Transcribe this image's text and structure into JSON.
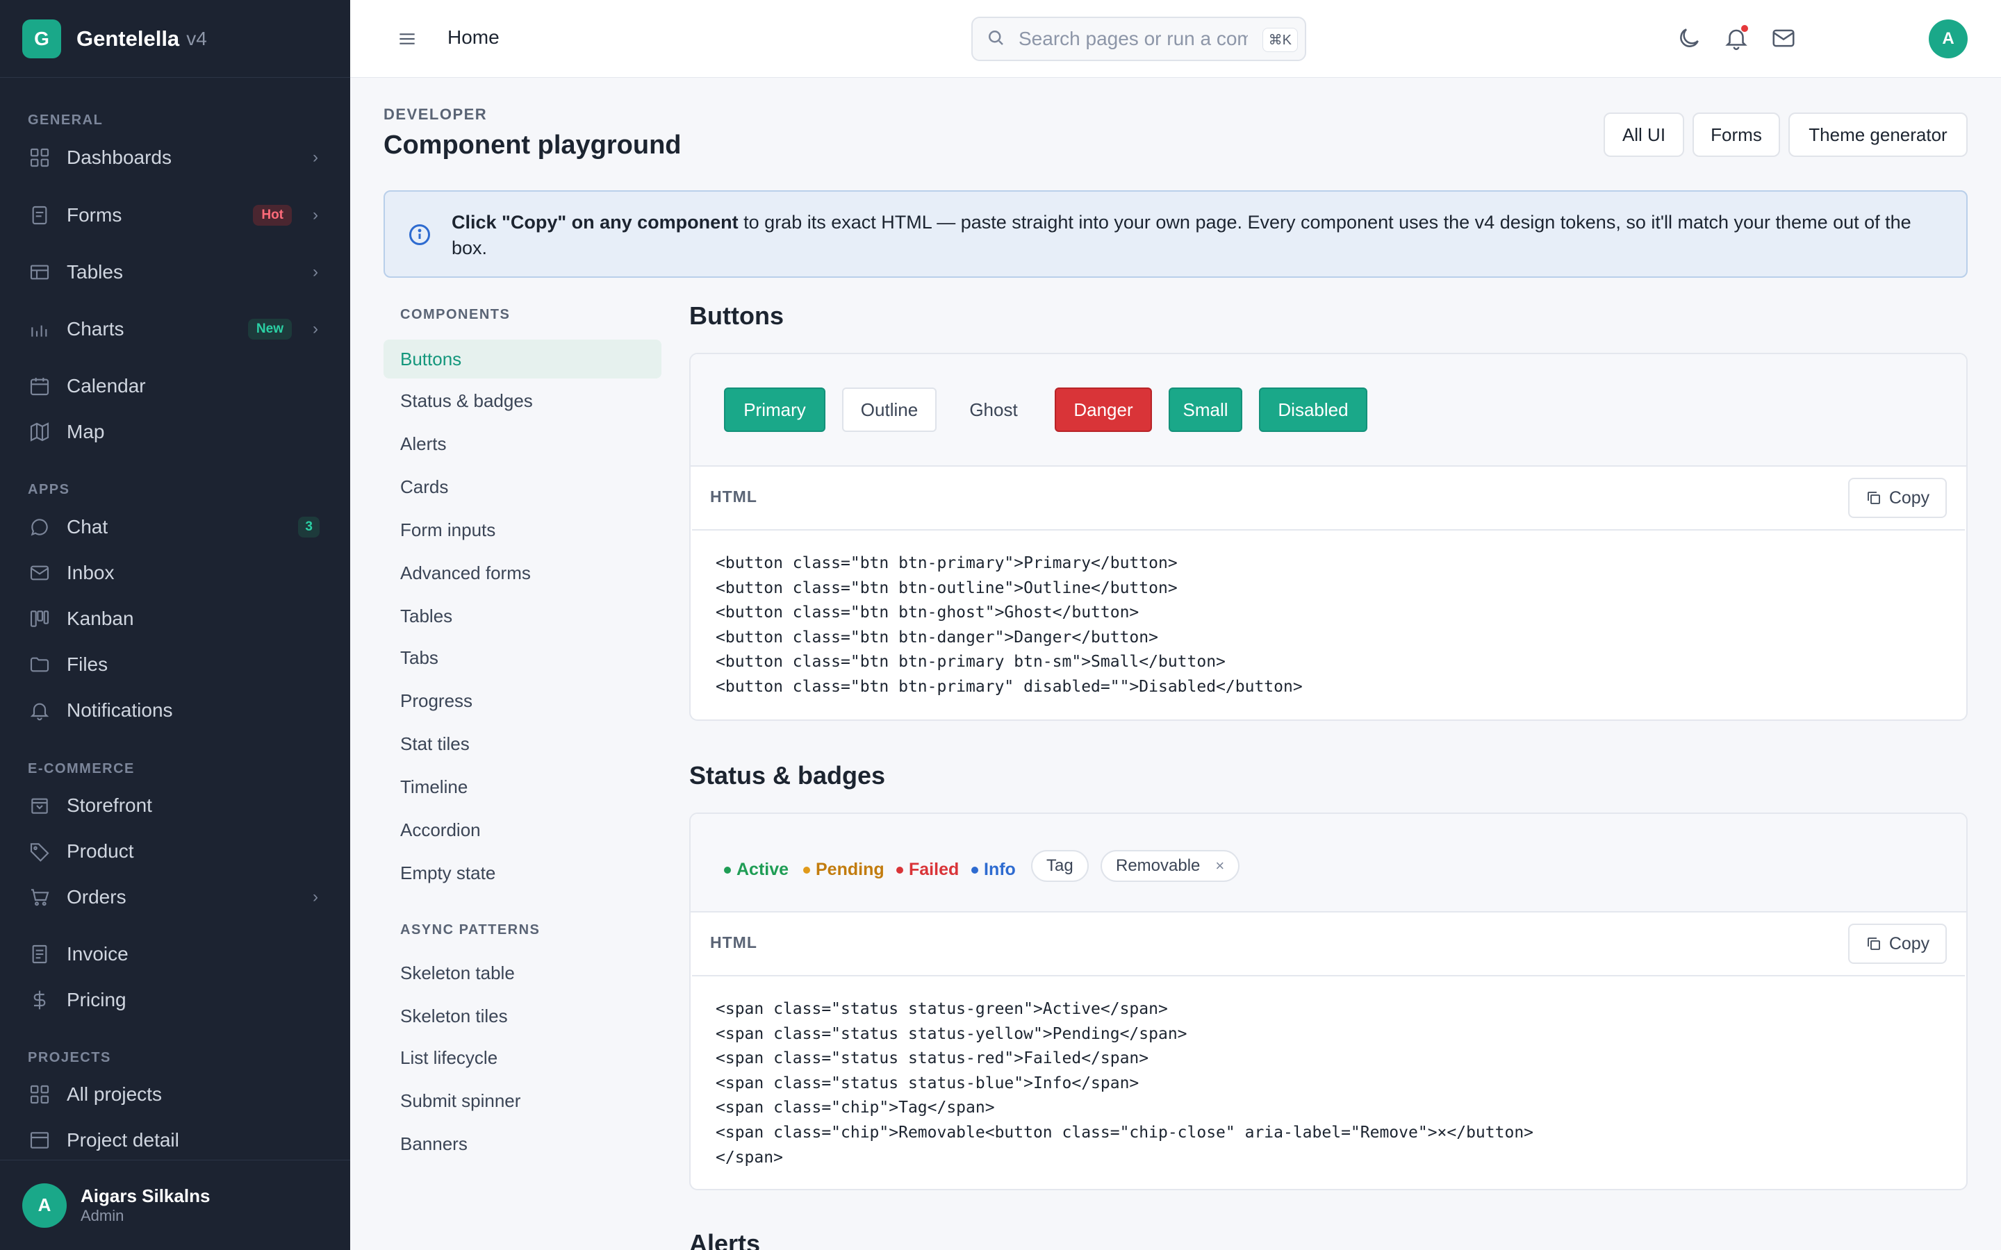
{
  "brand": {
    "logo": "G",
    "name": "Gentelella",
    "version": "v4"
  },
  "sidebar": {
    "sections": {
      "general": "GENERAL",
      "apps": "APPS",
      "ecommerce": "E-COMMERCE",
      "projects": "PROJECTS"
    },
    "items": [
      {
        "label": "Dashboards",
        "icon": "grid-icon"
      },
      {
        "label": "Forms",
        "icon": "form-icon",
        "badge": "Hot"
      },
      {
        "label": "Tables",
        "icon": "table-icon"
      },
      {
        "label": "Charts",
        "icon": "bar-chart-icon",
        "badge": "New"
      },
      {
        "label": "Calendar",
        "icon": "calendar-icon"
      },
      {
        "label": "Map",
        "icon": "map-icon"
      },
      {
        "label": "Chat",
        "icon": "chat-icon",
        "badge": "3"
      },
      {
        "label": "Inbox",
        "icon": "mail-icon"
      },
      {
        "label": "Kanban",
        "icon": "kanban-icon"
      },
      {
        "label": "Files",
        "icon": "folder-icon"
      },
      {
        "label": "Notifications",
        "icon": "bell-icon"
      },
      {
        "label": "Storefront",
        "icon": "store-icon"
      },
      {
        "label": "Product",
        "icon": "tag-icon"
      },
      {
        "label": "Orders",
        "icon": "cart-icon"
      },
      {
        "label": "Invoice",
        "icon": "invoice-icon"
      },
      {
        "label": "Pricing",
        "icon": "dollar-icon"
      },
      {
        "label": "All projects",
        "icon": "grid-icon"
      },
      {
        "label": "Project detail",
        "icon": "window-icon"
      }
    ],
    "user": {
      "initial": "A",
      "name": "Aigars Silkalns",
      "role": "Admin"
    }
  },
  "topbar": {
    "breadcrumb": "Home",
    "search_placeholder": "Search pages or run a command",
    "shortcut": "⌘K",
    "avatar_initial": "A"
  },
  "page": {
    "eyebrow": "DEVELOPER",
    "title": "Component playground",
    "header_buttons": [
      "All UI",
      "Forms",
      "Theme generator"
    ],
    "info_bold": "Click \"Copy\" on any component",
    "info_rest": " to grab its exact HTML — paste straight into your own page. Every component uses the v4 design tokens, so it'll match your theme out of the box."
  },
  "subnav": {
    "components_heading": "COMPONENTS",
    "components": [
      "Buttons",
      "Status & badges",
      "Alerts",
      "Cards",
      "Form inputs",
      "Advanced forms",
      "Tables",
      "Tabs",
      "Progress",
      "Stat tiles",
      "Timeline",
      "Accordion",
      "Empty state"
    ],
    "async_heading": "ASYNC PATTERNS",
    "async": [
      "Skeleton table",
      "Skeleton tiles",
      "List lifecycle",
      "Submit spinner",
      "Banners"
    ],
    "active": "Buttons"
  },
  "sections": {
    "buttons": {
      "title": "Buttons",
      "demo": [
        "Primary",
        "Outline",
        "Ghost",
        "Danger",
        "Small",
        "Disabled"
      ],
      "code_label": "HTML",
      "copy_label": "Copy",
      "code": "<button class=\"btn btn-primary\">Primary</button>\n<button class=\"btn btn-outline\">Outline</button>\n<button class=\"btn btn-ghost\">Ghost</button>\n<button class=\"btn btn-danger\">Danger</button>\n<button class=\"btn btn-primary btn-sm\">Small</button>\n<button class=\"btn btn-primary\" disabled=\"\">Disabled</button>"
    },
    "status": {
      "title": "Status & badges",
      "statuses": [
        "Active",
        "Pending",
        "Failed",
        "Info"
      ],
      "chips": [
        "Tag",
        "Removable"
      ],
      "chip_close": "×",
      "code_label": "HTML",
      "copy_label": "Copy",
      "code": "<span class=\"status status-green\">Active</span>\n<span class=\"status status-yellow\">Pending</span>\n<span class=\"status status-red\">Failed</span>\n<span class=\"status status-blue\">Info</span>\n<span class=\"chip\">Tag</span>\n<span class=\"chip\">Removable<button class=\"chip-close\" aria-label=\"Remove\">×</button>\n</span>"
    },
    "alerts": {
      "title": "Alerts"
    }
  },
  "colors": {
    "accent": "#1aa889",
    "sidebar_bg": "#1c2331",
    "danger": "#d93438",
    "status_green": "#1f9d55",
    "status_yellow": "#c27c0e",
    "status_red": "#d93438",
    "status_blue": "#2e6bd0"
  }
}
